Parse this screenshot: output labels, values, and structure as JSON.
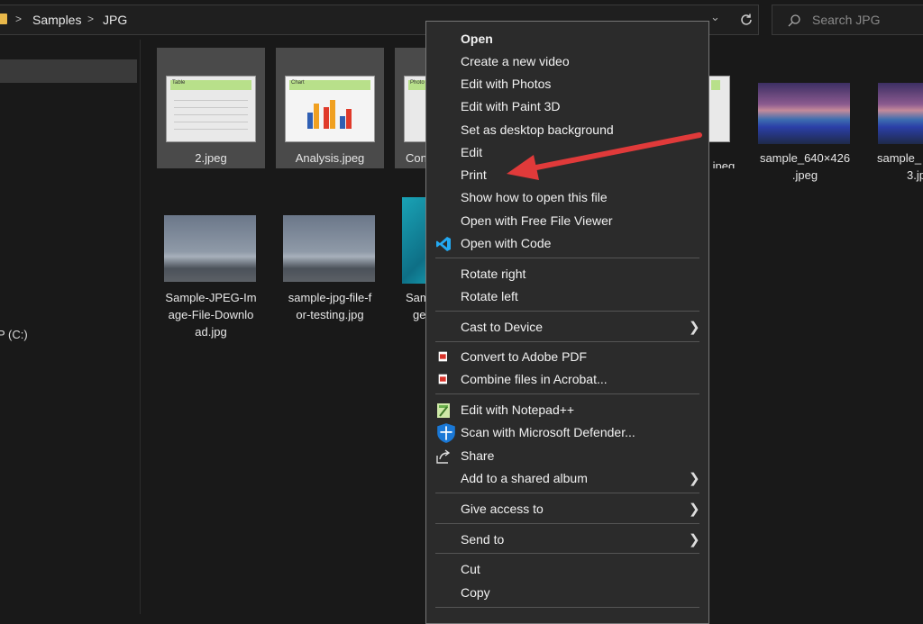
{
  "breadcrumb": {
    "items": [
      "Samples",
      "JPG"
    ],
    "separator": ">"
  },
  "search": {
    "placeholder": "Search JPG"
  },
  "nav": {
    "drive_label": "P (C:)"
  },
  "files": [
    {
      "name": "2.jpeg",
      "thumb_heading": "Table"
    },
    {
      "name": "Analysis.jpeg",
      "thumb_heading": "Chart"
    },
    {
      "name": "Con",
      "thumb_heading": "Photo"
    },
    {
      "name": ".jpeg"
    },
    {
      "name_lines": [
        "sample_640×426",
        ".jpeg"
      ]
    },
    {
      "name_lines": [
        "sample_",
        "3.jp"
      ]
    },
    {
      "name_lines": [
        "Sample-JPEG-Im",
        "age-File-Downlo",
        "ad.jpg"
      ]
    },
    {
      "name_lines": [
        "sample-jpg-file-f",
        "or-testing.jpg"
      ]
    },
    {
      "name_lines": [
        "Sam",
        "ge"
      ]
    }
  ],
  "context_menu": {
    "items": [
      {
        "label": "Open"
      },
      {
        "label": "Create a new video"
      },
      {
        "label": "Edit with Photos"
      },
      {
        "label": "Edit with Paint 3D"
      },
      {
        "label": "Set as desktop background"
      },
      {
        "label": "Edit"
      },
      {
        "label": "Print"
      },
      {
        "label": "Show how to open this file"
      },
      {
        "label": "Open with Free File Viewer"
      },
      {
        "label": "Open with Code",
        "icon": "vscode-icon"
      },
      {
        "label": "Rotate right"
      },
      {
        "label": "Rotate left"
      },
      {
        "label": "Cast to Device",
        "submenu": true
      },
      {
        "label": "Convert to Adobe PDF",
        "icon": "adobe-pdf-icon"
      },
      {
        "label": "Combine files in Acrobat...",
        "icon": "acrobat-combine-icon"
      },
      {
        "label": "Edit with Notepad++",
        "icon": "notepad-plus-plus-icon"
      },
      {
        "label": "Scan with Microsoft Defender...",
        "icon": "defender-shield-icon"
      },
      {
        "label": "Share",
        "icon": "share-icon"
      },
      {
        "label": "Add to a shared album",
        "submenu": true
      },
      {
        "label": "Give access to",
        "submenu": true
      },
      {
        "label": "Send to",
        "submenu": true
      },
      {
        "label": "Cut"
      },
      {
        "label": "Copy"
      }
    ]
  },
  "colors": {
    "background": "#191919",
    "menu_background": "#2b2b2b",
    "annotation_arrow": "#e03a3a",
    "selection": "#4a4a4a"
  }
}
